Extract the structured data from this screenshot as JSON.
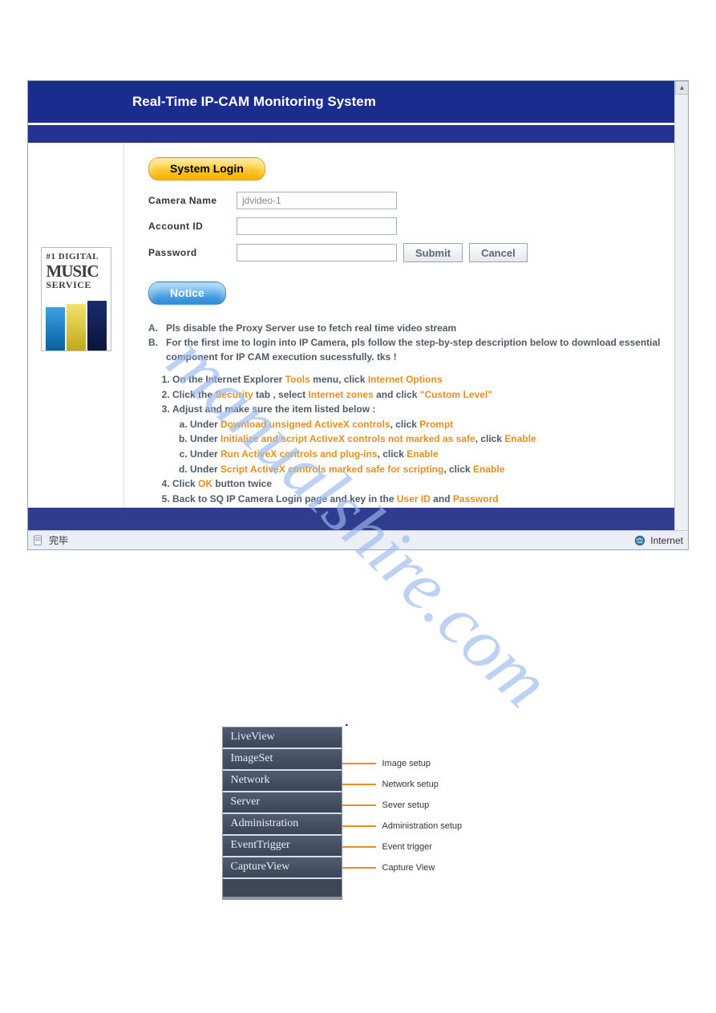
{
  "watermark_text": "manualshire.com",
  "browser": {
    "status_left": "完毕",
    "zone_label": "Internet"
  },
  "app": {
    "title": "Real-Time IP-CAM Monitoring System",
    "login_badge": "System Login",
    "notice_badge": "Notice",
    "form": {
      "camera_label": "Camera Name",
      "camera_value": "jdvideo-1",
      "account_label": "Account ID",
      "account_value": "",
      "password_label": "Password",
      "password_value": "",
      "submit_label": "Submit",
      "cancel_label": "Cancel"
    },
    "ad": {
      "line1": "#1 DIGITAL",
      "line2": "MUSIC",
      "line3": "SERVICE"
    },
    "notice_lead": {
      "A": "Pls disable the Proxy Server use to fetch real time video stream",
      "B": "For the first ime to login into IP Camera, pls follow the step-by-step description below to download essential component for IP CAM execution sucessfully. tks !"
    },
    "steps": {
      "s1_a": "On the Internet Explorer ",
      "s1_b": "Tools",
      "s1_c": " menu, click ",
      "s1_d": "Internet Options",
      "s2_a": "Click the ",
      "s2_b": "Security",
      "s2_c": " tab , select ",
      "s2_d": "Internet zones",
      "s2_e": " and click ",
      "s2_f": "Custom Level",
      "s3": "Adjust and make sure the item listed below :",
      "s3a_a": "Under ",
      "s3a_b": "Download unsigned ActiveX controls",
      "s3a_c": ", click ",
      "s3a_d": "Prompt",
      "s3b_a": "Under ",
      "s3b_b": "Initialize and script ActiveX controls not marked as safe",
      "s3b_c": ", click ",
      "s3b_d": "Enable",
      "s3c_a": "Under ",
      "s3c_b": "Run ActiveX controls and plug-ins",
      "s3c_c": ", click ",
      "s3c_d": "Enable",
      "s3d_a": "Under ",
      "s3d_b": "Script ActiveX controls marked safe for scripting",
      "s3d_c": ", click ",
      "s3d_d": "Enable",
      "s4_a": "Click ",
      "s4_b": "OK",
      "s4_c": " button twice",
      "s5_a": "Back to SQ IP Camera Login page and key in the ",
      "s5_b": "User ID",
      "s5_c": " and ",
      "s5_d": "Password"
    }
  },
  "menu": {
    "items": [
      {
        "label": "LiveView",
        "callout": ""
      },
      {
        "label": "ImageSet",
        "callout": "Image setup"
      },
      {
        "label": "Network",
        "callout": "Network setup"
      },
      {
        "label": "Server",
        "callout": "Sever setup"
      },
      {
        "label": "Administration",
        "callout": "Administration setup"
      },
      {
        "label": "EventTrigger",
        "callout": "Event trigger"
      },
      {
        "label": "CaptureView",
        "callout": "Capture View"
      }
    ]
  }
}
